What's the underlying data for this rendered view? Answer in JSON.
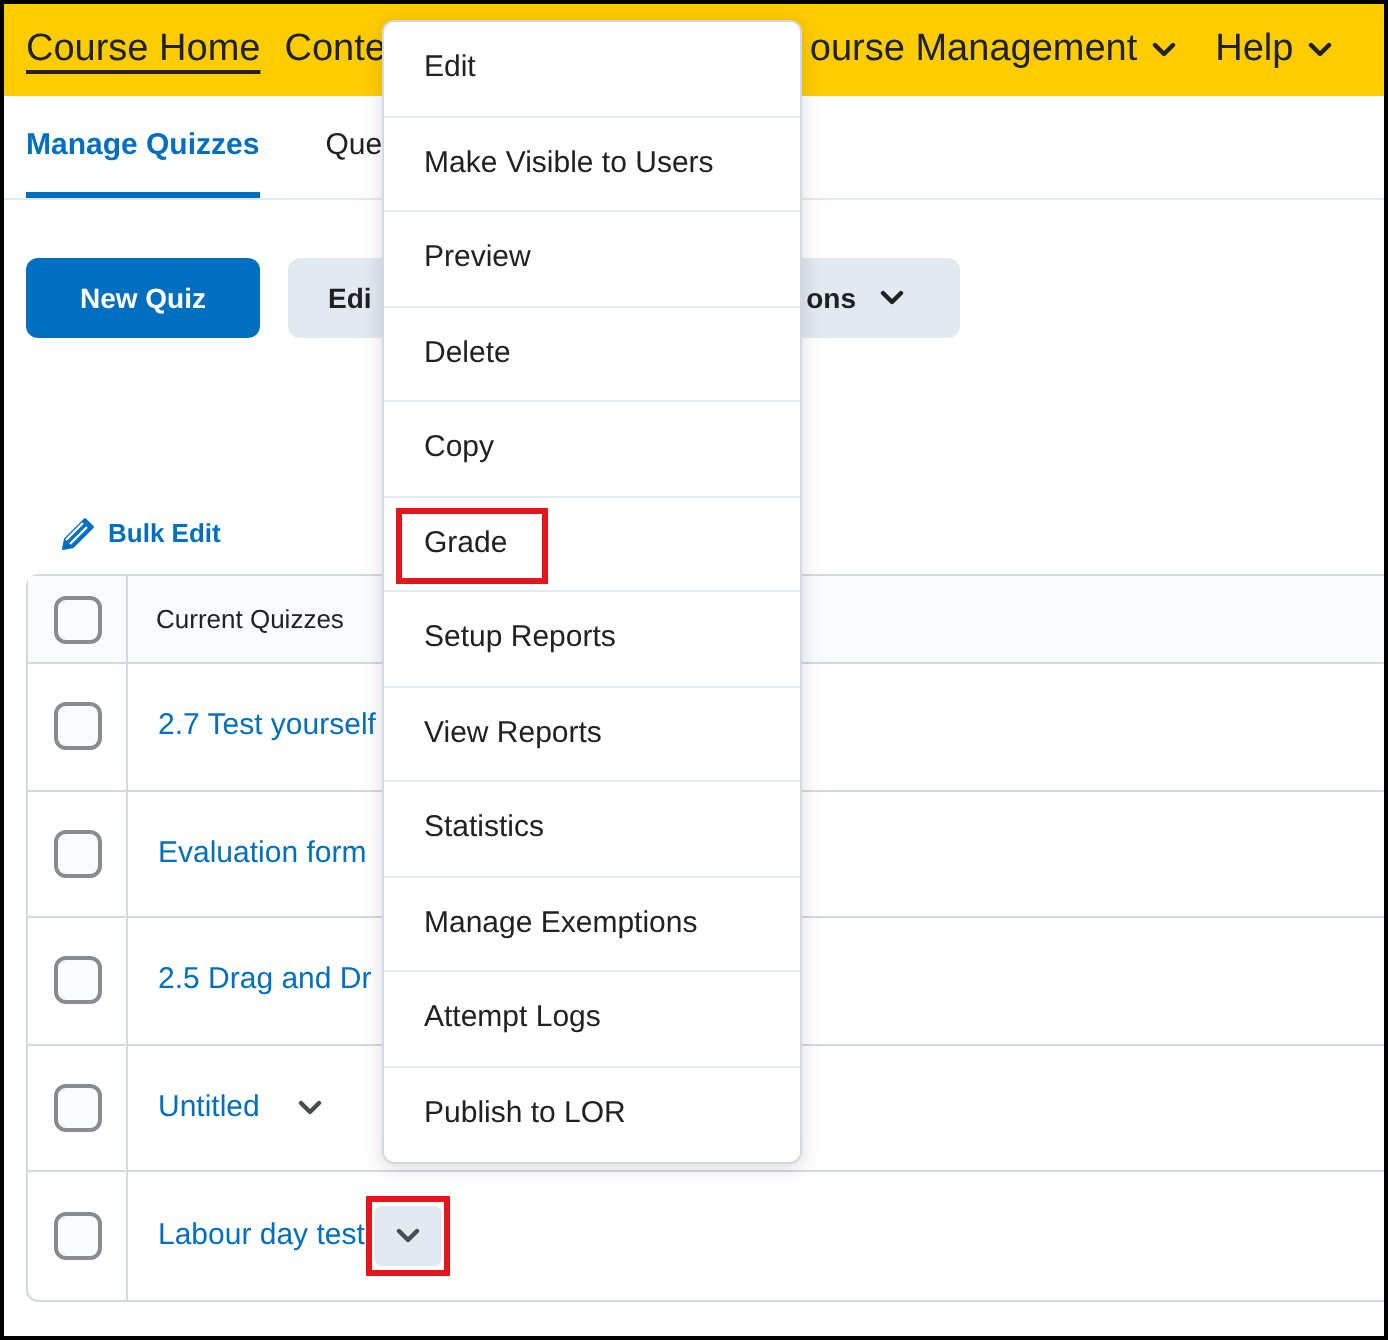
{
  "nav": [
    {
      "label": "Course Home",
      "current": true,
      "dropdown": false
    },
    {
      "label": "Conte",
      "current": false,
      "dropdown": false
    },
    {
      "label": "ourse Management",
      "current": false,
      "dropdown": true
    },
    {
      "label": "Help",
      "current": false,
      "dropdown": true
    }
  ],
  "tabs": [
    {
      "label": "Manage Quizzes",
      "selected": true
    },
    {
      "label": "Que",
      "selected": false
    }
  ],
  "buttons": [
    {
      "label": "New Quiz",
      "kind": "primary"
    },
    {
      "label": "Edi",
      "kind": "secondary"
    },
    {
      "label": "ons",
      "kind": "dropdown"
    }
  ],
  "bulk_edit": {
    "label": "Bulk Edit"
  },
  "table": {
    "header": {
      "label": "Current Quizzes",
      "checked": false
    },
    "rows": [
      {
        "title": "2.7 Test yourself",
        "checked": false,
        "highlighted": false
      },
      {
        "title": "Evaluation form",
        "checked": false,
        "highlighted": false
      },
      {
        "title": "2.5 Drag and Dr",
        "checked": false,
        "highlighted": false
      },
      {
        "title": "Untitled",
        "checked": false,
        "chevron": true,
        "highlighted": false
      },
      {
        "title": "Labour day test",
        "checked": false,
        "chevron": true,
        "highlighted": true
      }
    ]
  },
  "context_menu": {
    "items": [
      {
        "label": "Edit",
        "highlighted": false
      },
      {
        "label": "Make Visible to Users",
        "highlighted": false
      },
      {
        "label": "Preview",
        "highlighted": false
      },
      {
        "label": "Delete",
        "highlighted": false
      },
      {
        "label": "Copy",
        "highlighted": false
      },
      {
        "label": "Grade",
        "highlighted": true
      },
      {
        "label": "Setup Reports",
        "highlighted": false
      },
      {
        "label": "View Reports",
        "highlighted": false
      },
      {
        "label": "Statistics",
        "highlighted": false
      },
      {
        "label": "Manage Exemptions",
        "highlighted": false
      },
      {
        "label": "Attempt Logs",
        "highlighted": false
      },
      {
        "label": "Publish to LOR",
        "highlighted": false
      }
    ]
  }
}
